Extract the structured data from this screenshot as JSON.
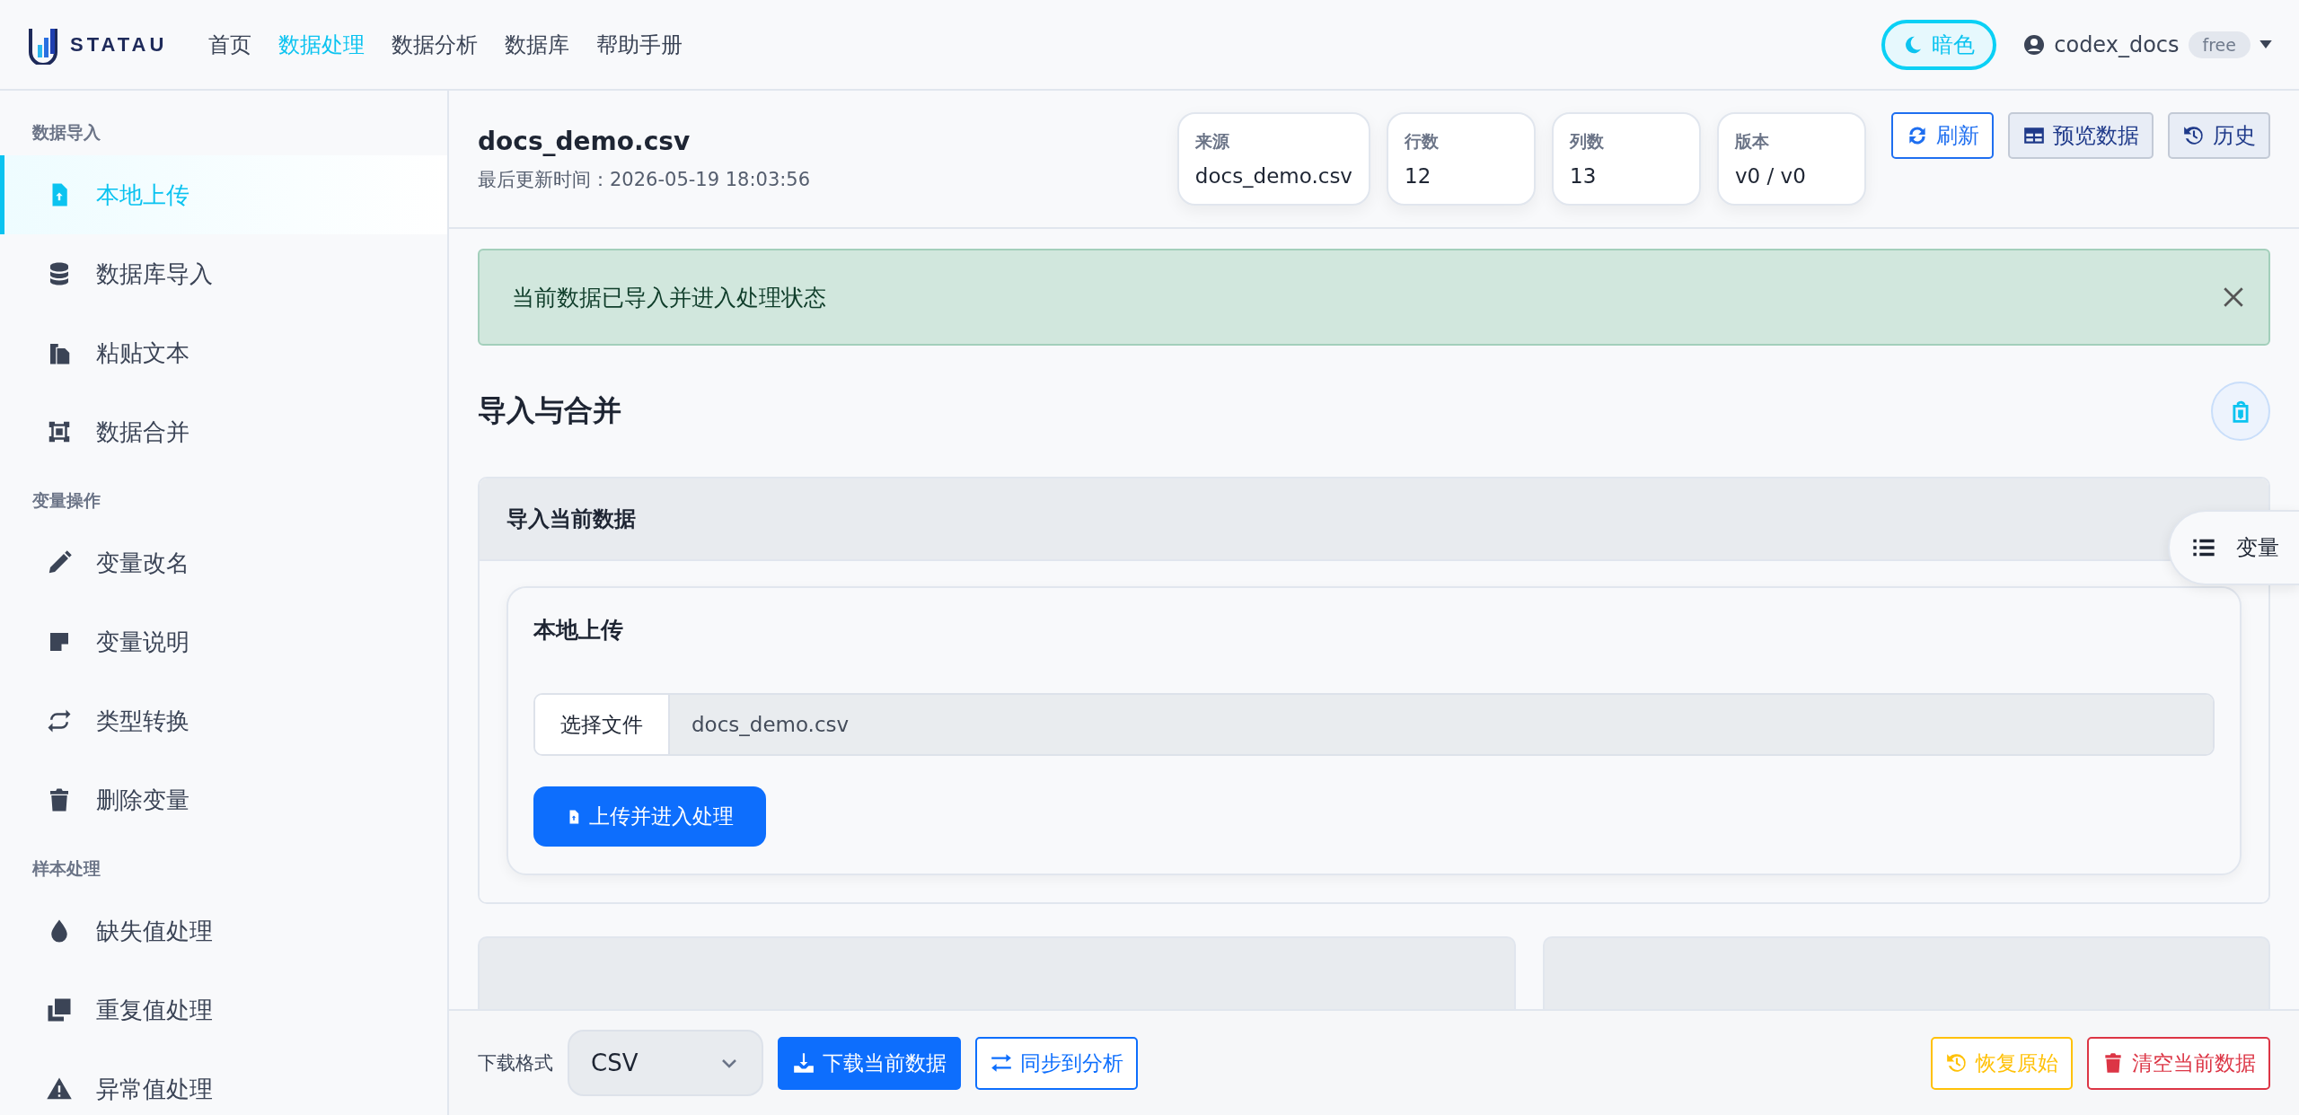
{
  "brand": {
    "name": "STATAU"
  },
  "nav": [
    {
      "label": "首页",
      "selected": false
    },
    {
      "label": "数据处理",
      "selected": true
    },
    {
      "label": "数据分析",
      "selected": false
    },
    {
      "label": "数据库",
      "selected": false
    },
    {
      "label": "帮助手册",
      "selected": false
    }
  ],
  "theme_toggle": {
    "label": "暗色"
  },
  "user": {
    "name": "codex_docs",
    "plan": "free"
  },
  "sidebar": {
    "sections": [
      {
        "title": "数据导入",
        "items": [
          {
            "label": "本地上传",
            "selected": true
          },
          {
            "label": "数据库导入",
            "selected": false
          },
          {
            "label": "粘贴文本",
            "selected": false
          },
          {
            "label": "数据合并",
            "selected": false
          }
        ]
      },
      {
        "title": "变量操作",
        "items": [
          {
            "label": "变量改名",
            "selected": false
          },
          {
            "label": "变量说明",
            "selected": false
          },
          {
            "label": "类型转换",
            "selected": false
          },
          {
            "label": "删除变量",
            "selected": false
          }
        ]
      },
      {
        "title": "样本处理",
        "items": [
          {
            "label": "缺失值处理",
            "selected": false
          },
          {
            "label": "重复值处理",
            "selected": false
          },
          {
            "label": "异常值处理",
            "selected": false
          }
        ]
      }
    ]
  },
  "file": {
    "name": "docs_demo.csv",
    "updated": "最后更新时间：2026-05-19 18:03:56"
  },
  "stats": [
    {
      "label": "来源",
      "value": "docs_demo.csv"
    },
    {
      "label": "行数",
      "value": "12"
    },
    {
      "label": "列数",
      "value": "13"
    },
    {
      "label": "版本",
      "value": "v0 / v0"
    }
  ],
  "actions": [
    {
      "label": "刷新",
      "kind": "outline"
    },
    {
      "label": "预览数据",
      "kind": "soft"
    },
    {
      "label": "历史",
      "kind": "soft"
    }
  ],
  "alert": {
    "text": "当前数据已导入并进入处理状态"
  },
  "section_title": "导入与合并",
  "import_card": {
    "title": "导入当前数据",
    "subcard_title": "本地上传",
    "file_button": "选择文件",
    "file_value": "docs_demo.csv",
    "submit": "上传并进入处理"
  },
  "side_pill": {
    "label": "变量"
  },
  "footer": {
    "format_label": "下载格式",
    "format_value": "CSV",
    "buttons": [
      {
        "label": "下载当前数据",
        "kind": "primary"
      },
      {
        "label": "同步到分析",
        "kind": "outline"
      },
      {
        "label": "恢复原始",
        "kind": "warning"
      },
      {
        "label": "清空当前数据",
        "kind": "danger"
      }
    ]
  }
}
